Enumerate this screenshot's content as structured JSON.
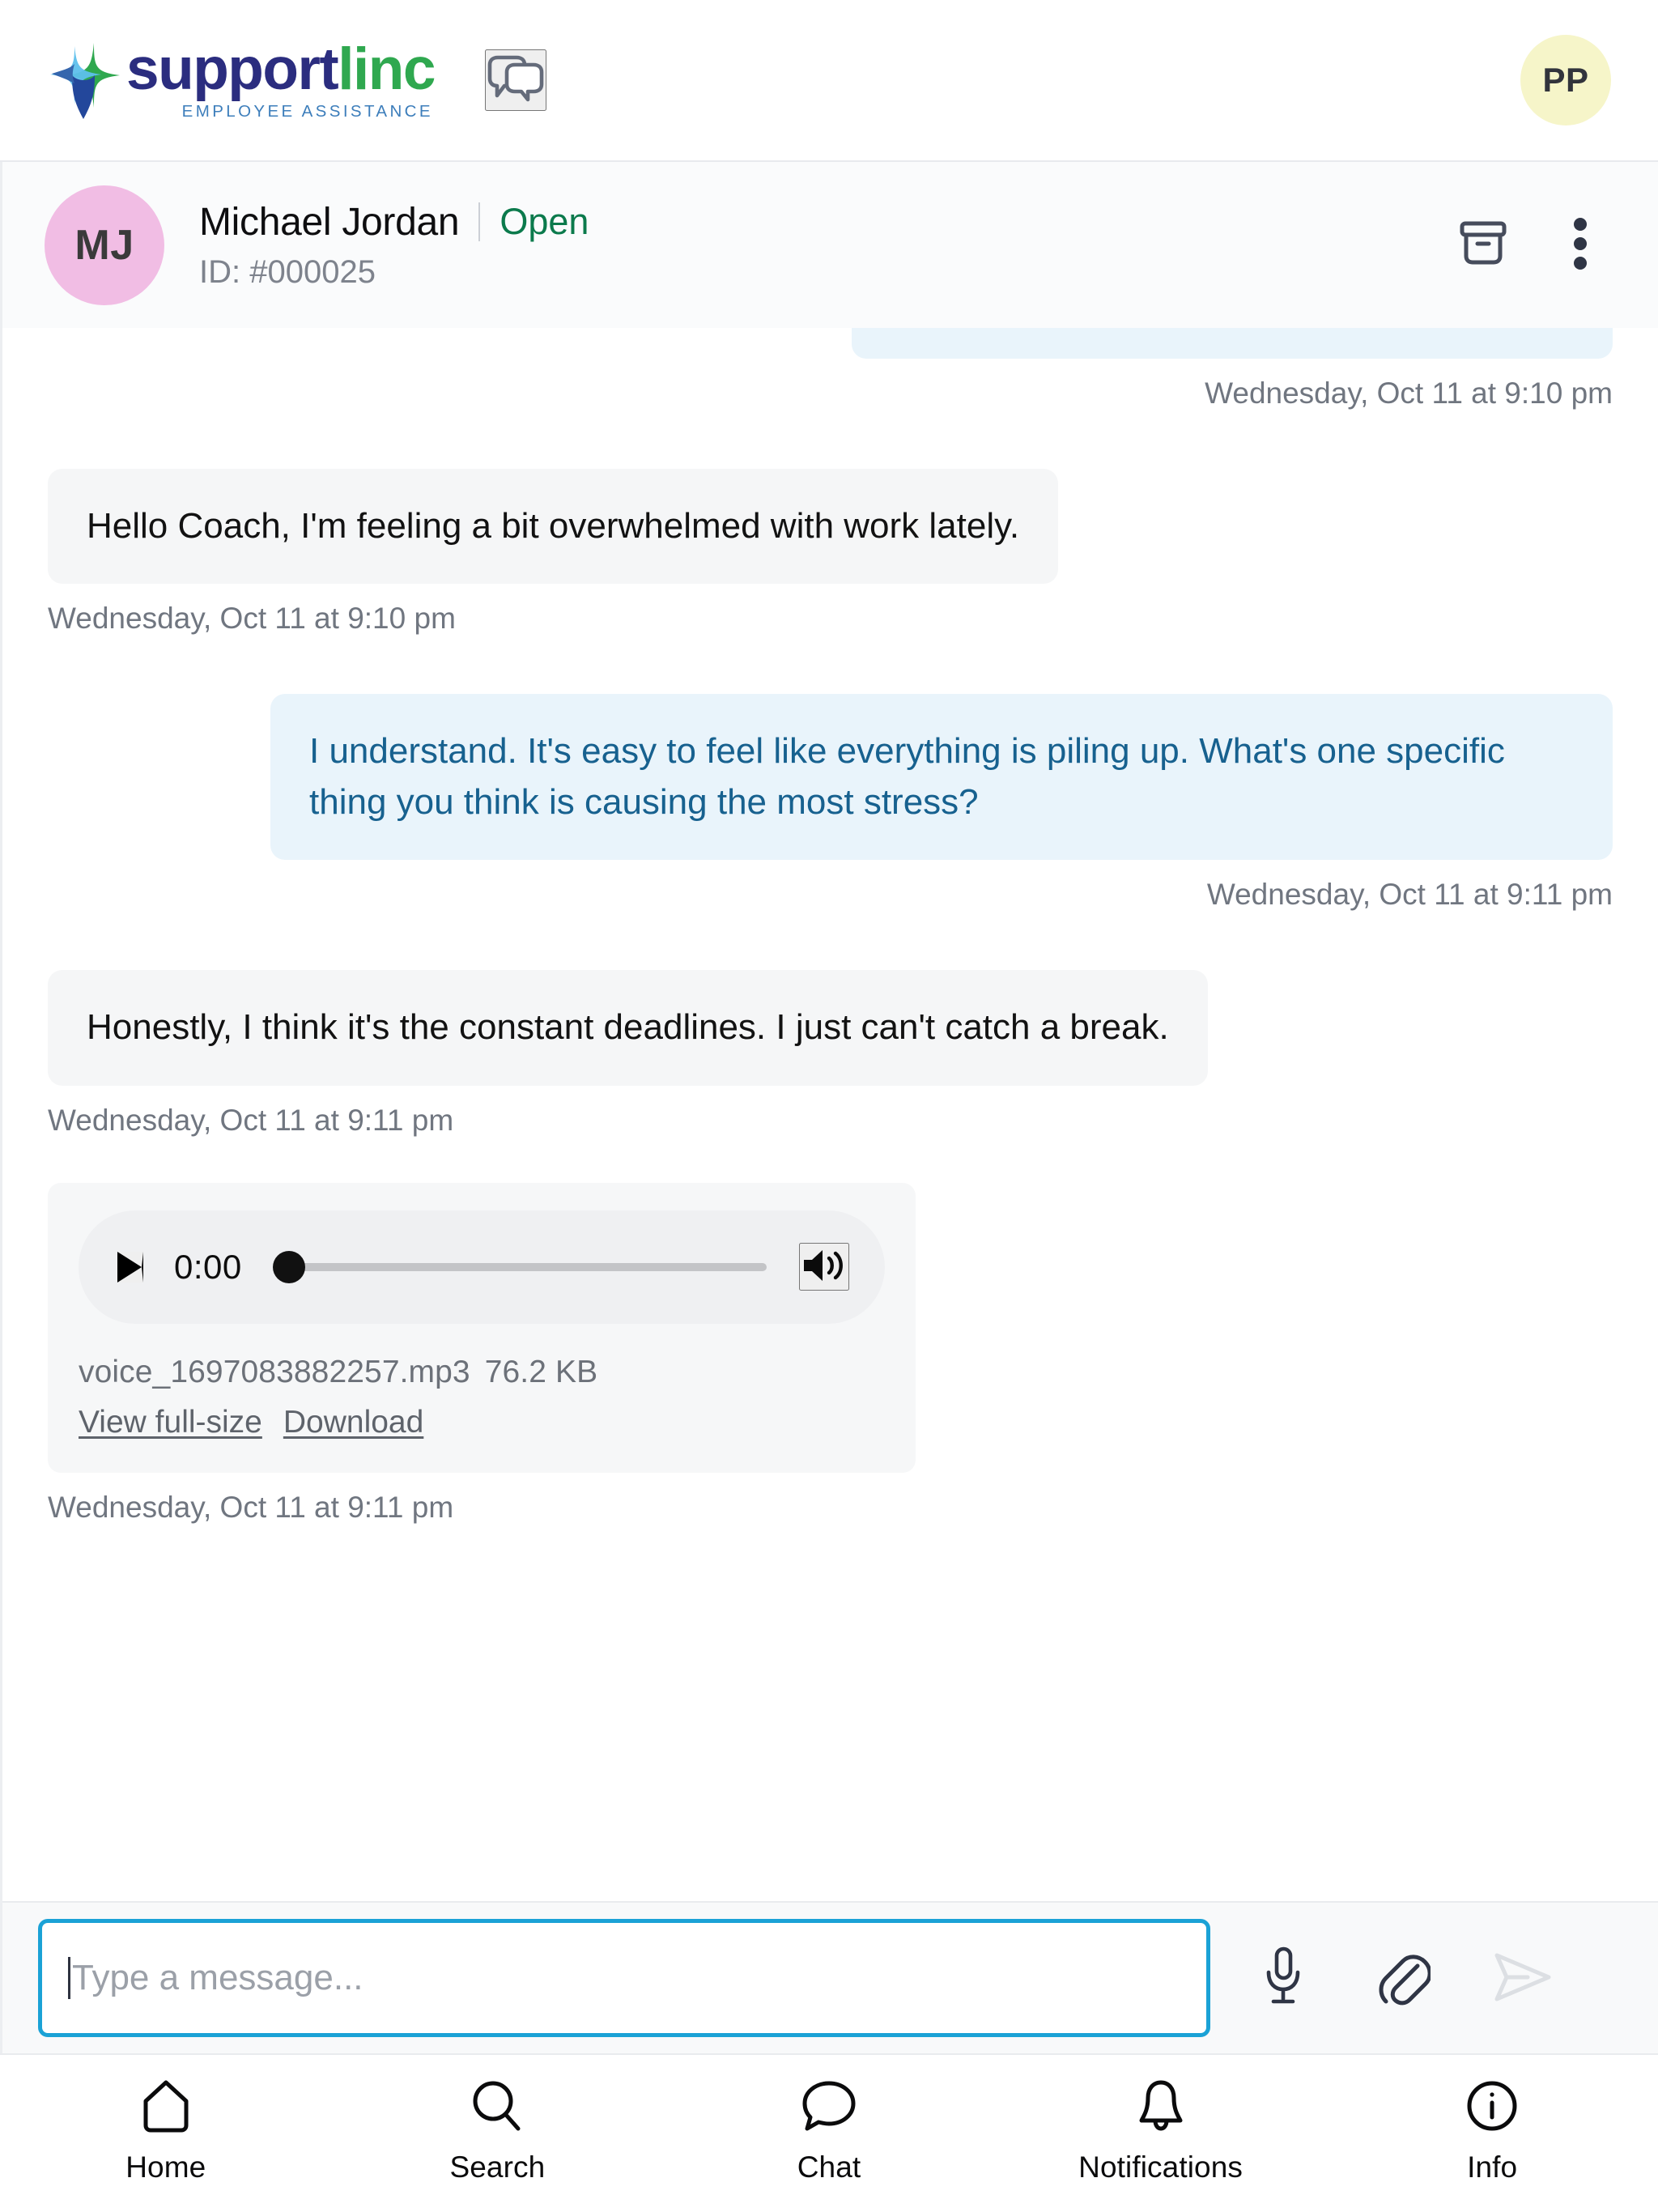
{
  "topbar": {
    "brand_main_first": "support",
    "brand_main_second": "linc",
    "brand_tagline": "EMPLOYEE ASSISTANCE",
    "chat_icon": "double-speech-bubble-icon",
    "avatar_initials": "PP",
    "avatar_color": "#f6f5c9"
  },
  "conversation": {
    "avatar_initials": "MJ",
    "avatar_color": "#f1bde4",
    "name": "Michael Jordan",
    "status": "Open",
    "status_color": "#0b7a4c",
    "id_label": "ID: #000025",
    "archive_icon": "archive-box-icon",
    "more_icon": "more-vertical-icon"
  },
  "messages": [
    {
      "id": "m0",
      "direction": "out",
      "text": "",
      "clipped": true,
      "timestamp": "Wednesday, Oct 11 at 9:10 pm"
    },
    {
      "id": "m1",
      "direction": "in",
      "text": "Hello Coach, I'm feeling a bit overwhelmed with work lately.",
      "timestamp": "Wednesday, Oct 11 at 9:10 pm"
    },
    {
      "id": "m2",
      "direction": "out",
      "text": "I understand. It's easy to feel like everything is piling up. What's one specific thing you think is causing the most stress?",
      "timestamp": "Wednesday, Oct 11 at 9:11 pm"
    },
    {
      "id": "m3",
      "direction": "in",
      "text": "Honestly, I think it's the constant deadlines. I just can't catch a break.",
      "timestamp": "Wednesday, Oct 11 at 9:11 pm"
    }
  ],
  "attachment": {
    "play_icon": "play-icon",
    "current_time": "0:00",
    "progress_percent": 0,
    "volume_icon": "volume-icon",
    "filename": "voice_1697083882257.mp3",
    "filesize": "76.2 KB",
    "view_link": "View full-size",
    "download_link": "Download",
    "timestamp": "Wednesday, Oct 11 at 9:11 pm"
  },
  "composer": {
    "placeholder": "Type a message...",
    "value": "",
    "border_color": "#1ba2d6",
    "mic_icon": "microphone-icon",
    "attach_icon": "paperclip-icon",
    "send_icon": "send-icon"
  },
  "bottomnav": {
    "items": [
      {
        "label": "Home",
        "icon": "home-icon"
      },
      {
        "label": "Search",
        "icon": "search-icon"
      },
      {
        "label": "Chat",
        "icon": "chat-bubble-icon"
      },
      {
        "label": "Notifications",
        "icon": "bell-icon"
      },
      {
        "label": "Info",
        "icon": "info-circle-icon"
      }
    ]
  }
}
